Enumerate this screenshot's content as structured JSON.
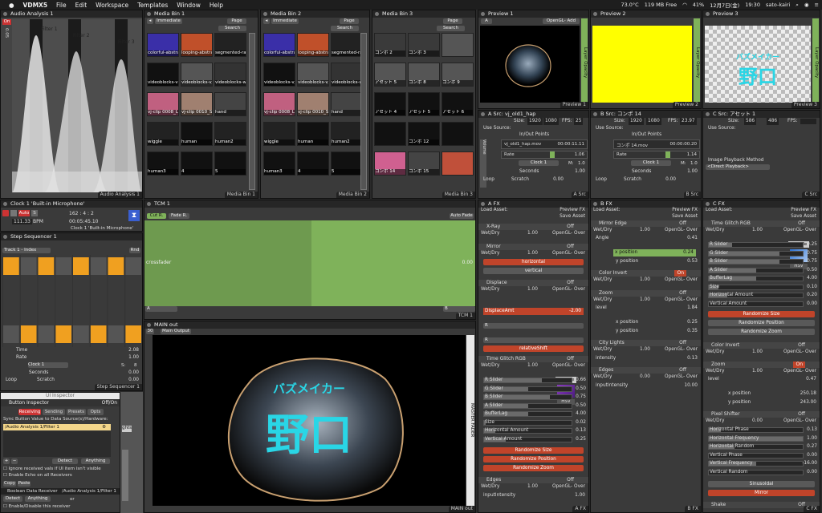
{
  "menubar": {
    "apple": "",
    "app": "VDMX5",
    "items": [
      "File",
      "Edit",
      "Workspace",
      "Templates",
      "Window",
      "Help"
    ],
    "status": {
      "temp": "73.0°C",
      "mem": "119 MB Free",
      "battery": "41%",
      "date": "12月7日(金)",
      "time": "19:30",
      "user": "sato-kairi"
    }
  },
  "audio_analysis": {
    "title": "Audio Analysis 1",
    "filters": [
      "Filter 1",
      "Filter 2",
      "Filter 3"
    ],
    "on": "On",
    "footer": "Audio Analysis 1",
    "level": "0.05"
  },
  "bin1": {
    "title": "Media Bin 1",
    "mode": "Immediate",
    "page": "Page",
    "search": "Search",
    "items": [
      "colorful-abstra",
      "looping-abstrac",
      "segmented-rac",
      "videoblocks-vi",
      "videoblocks-vj",
      "videoblocks-w",
      "vj-clip 0008_LA",
      "vj-clip 0010_SU",
      "hand",
      "wiggle",
      "human",
      "human2",
      "human3",
      "4",
      "5"
    ],
    "footer": "Media Bin 1"
  },
  "bin2": {
    "title": "Media Bin 2",
    "mode": "Immediate",
    "page": "Page",
    "search": "Search",
    "items": [
      "colorful-abstra",
      "looping-abstrac",
      "segmented-rac",
      "videoblocks-vj",
      "videoblocks-vj",
      "videoblocks-w",
      "vj-clip 0008_LA",
      "vj-clip 0010_SU",
      "hand",
      "wiggle",
      "human",
      "human2",
      "human3",
      "4",
      "5"
    ],
    "footer": "Media Bin 2"
  },
  "bin3": {
    "title": "Media Bin 3",
    "page": "Page",
    "search": "Search",
    "items": [
      "コンポ 2",
      "コンポ 3",
      "",
      "アセット 5",
      "コンポ 8",
      "コンポ 9",
      "アセット 4",
      "アセット 5",
      "アセット 6",
      "",
      "コンポ 12",
      "",
      "コンポ 14",
      "コンポ 15",
      ""
    ],
    "footer": "Media Bin 3"
  },
  "preview1": {
    "title": "Preview 1",
    "src": "A",
    "mode": "OpenGL- Add",
    "footer": "Preview 1",
    "side": "Layer Opacity",
    "val": "1.00"
  },
  "preview2": {
    "title": "Preview 2",
    "footer": "Preview 2",
    "side": "Layer Opacity",
    "val": "1.00"
  },
  "preview3": {
    "title": "Preview 3",
    "text_top": "バズメイカー",
    "text_main": "野口",
    "footer": "Preview 3",
    "side": "Layer Opacity",
    "val": "1.00"
  },
  "srcA": {
    "title": "A Src: vj_old1_hap",
    "size_lbl": "Size:",
    "w": "1920",
    "h": "1080",
    "fps_lbl": "FPS:",
    "fps": "25",
    "use_source": "Use Source:",
    "inout": "In/Out Points",
    "file": "vj_old1_hap.mov",
    "time": "00:00:11.11",
    "rate_lbl": "Rate",
    "rate": "1.06",
    "clock": "Clock 1",
    "m_lbl": "M:",
    "m": "1.0",
    "seconds": "Seconds",
    "seconds_val": "1.00",
    "loop": "Loop",
    "scratch": "Scratch",
    "scratch_val": "0.00",
    "volume": "Volume",
    "footer": "A Src"
  },
  "srcB": {
    "title": "B Src: コンポ 14",
    "size_lbl": "Size:",
    "w": "1920",
    "h": "1080",
    "fps_lbl": "FPS:",
    "fps": "23.97",
    "use_source": "Use Source:",
    "inout": "In/Out Points",
    "file": "コンポ 14.mov",
    "time": "00:00:00.20",
    "rate_lbl": "Rate",
    "rate": "1.14",
    "clock": "Clock 1",
    "m_lbl": "M:",
    "m": "1.0",
    "seconds": "Seconds",
    "seconds_val": "1.00",
    "loop": "Loop",
    "scratch": "Scratch",
    "scratch_val": "0.00",
    "footer": "B Src"
  },
  "srcC": {
    "title": "C Src: アセット 1",
    "size_lbl": "Size:",
    "w": "586",
    "h": "486",
    "fps_lbl": "FPS:",
    "fps": "",
    "use_source": "Use Source:",
    "method_lbl": "Image Playback Method",
    "method": "<Direct Playback>",
    "footer": "C Src"
  },
  "clock": {
    "title": "Clock 1 'Built-in Microphone'",
    "auto": "Auto",
    "s": "S",
    "time_sig": "162 : 4 : 2",
    "bpm": "111.33",
    "bpm_lbl": "BPM",
    "elapsed": "00:05:45.10",
    "source": "Clock 1 'Built-in Microphone'"
  },
  "stepseq": {
    "title": "Step Sequencer 1",
    "track": "Track 1 - Index",
    "rnd": "Rnd",
    "time_lbl": "Time",
    "time": "2.08",
    "rate_lbl": "Rate",
    "rate": "1.00",
    "clock": "Clock 1",
    "s_lbl": "S:",
    "s": "8",
    "seconds": "Seconds",
    "seconds_val": "0.00",
    "loop": "Loop",
    "scratch": "Scratch",
    "scratch_val": "0.00",
    "footer": "Step Sequencer 1"
  },
  "tcm": {
    "title": "TCM 1",
    "cut": "Cut R.",
    "fade": "Fade R.",
    "auto_fade": "Auto Fade",
    "label": "crossfader",
    "val": "0.00",
    "a": "A",
    "b": "B",
    "footer": "TCM 1"
  },
  "main_out": {
    "title": "MAIN out",
    "res": "30",
    "output": "Main Output",
    "text_top": "バズメイカー",
    "text_main": "野口",
    "fader": "MASTER FADER",
    "val": "1.00",
    "footer": "MAIN out"
  },
  "ui_inspector": {
    "title": "UI Inspector",
    "panel": "Button Inspector",
    "offon": "Off/On",
    "tabs": [
      "Receiving",
      "Sending",
      "Presets",
      "Opts"
    ],
    "sync_lbl": "Sync Button Value to Data Source(s)/Hardware:",
    "source": "/Audio Analysis 1/Filter 1",
    "detect": "Detect",
    "anything": "Anything",
    "chk1": "Ignore received vals if UI item isn't visible",
    "chk2": "Enable Echo on all Receivers",
    "copy": "Copy",
    "paste": "Paste",
    "bool_lbl": "Boolean Data Receiver",
    "bool_src": "/Audio Analysis 1/Filter 1",
    "detect2": "Detect",
    "anything2": "Anything",
    "or": "or",
    "enable": "Enable/Disable this receiver",
    "lights": "ghts"
  },
  "fxA": {
    "title": "A FX",
    "load": "Load Asset:",
    "preview": "Preview FX",
    "save": "Save Asset",
    "footer": "A FX",
    "sections": [
      {
        "name": "X-Ray",
        "off": "Off",
        "wd": "1.00",
        "blend": "OpenGL- Over"
      },
      {
        "name": "Mirror",
        "off": "Off",
        "wd": "1.00",
        "blend": "OpenGL- Over",
        "btns": [
          "horizontal",
          "vertical"
        ]
      },
      {
        "name": "Displace",
        "off": "Off",
        "wd": "1.00",
        "blend": "OpenGL- Over",
        "param": "DisplaceAmt",
        "pval": "-2.00",
        "r": "R",
        "btn": "relativeShift"
      },
      {
        "name": "Time Glitch RGB",
        "off": "Off",
        "wd": "1.00",
        "blend": "OpenGL- Over",
        "sliders": [
          [
            "R Slider",
            "0.66"
          ],
          [
            "G Slider",
            "0.50"
          ],
          [
            "B Slider",
            "0.75"
          ],
          [
            "A Slider",
            "0.50"
          ],
          [
            "BufferLag",
            "4.00"
          ],
          [
            "Size",
            "0.02"
          ],
          [
            "Horizontal Amount",
            "0.13"
          ],
          [
            "Vertical Amount",
            "0.25"
          ]
        ],
        "sample": "Sample",
        "hsv": "HSV",
        "btns": [
          "Randomize Size",
          "Randomize Position",
          "Randomize Zoom"
        ]
      },
      {
        "name": "Edges",
        "off": "Off",
        "wd": "1.00",
        "blend": "OpenGL- Over",
        "param": "inputIntensity",
        "pval": "1.00"
      }
    ]
  },
  "fxB": {
    "title": "B FX",
    "load": "Load Asset:",
    "preview": "Preview FX",
    "save": "Save Asset",
    "footer": "B FX",
    "mirror_edge": {
      "name": "Mirror Edge",
      "off": "Off",
      "wd": "1.00",
      "blend": "OpenGL- Over",
      "angle_lbl": "Angle",
      "angle": "0.41",
      "xpos_lbl": "x position",
      "xpos": "0.24",
      "ypos_lbl": "y position",
      "ypos": "0.53"
    },
    "color_invert": {
      "name": "Color Invert",
      "on": "On",
      "wd": "1.00",
      "blend": "OpenGL- Over"
    },
    "zoom": {
      "name": "Zoom",
      "off": "Off",
      "wd": "1.00",
      "blend": "OpenGL- Over",
      "level_lbl": "level",
      "level": "1.84",
      "xpos_lbl": "x position",
      "xpos": "0.25",
      "ypos_lbl": "y position",
      "ypos": "0.35"
    },
    "city": {
      "name": "City Lights",
      "off": "Off",
      "wd": "1.00",
      "blend": "OpenGL- Over",
      "int_lbl": "intensity",
      "int": "0.13"
    },
    "edges": {
      "name": "Edges",
      "off": "Off",
      "wd": "0.00",
      "blend": "OpenGL- Over",
      "int_lbl": "inputIntensity",
      "int": "10.00"
    }
  },
  "fxC": {
    "title": "C FX",
    "load": "Load Asset:",
    "preview": "Preview FX",
    "save": "Save Asset",
    "footer": "C FX",
    "tg": {
      "name": "Time Glitch RGB",
      "off": "Off",
      "wd": "1.00",
      "blend": "OpenGL- Over",
      "sliders": [
        [
          "R Slider",
          "0.25"
        ],
        [
          "G Slider",
          "0.75"
        ],
        [
          "B Slider",
          "0.75"
        ],
        [
          "A Slider",
          "0.50"
        ],
        [
          "BufferLag",
          "4.00"
        ],
        [
          "Size",
          "0.10"
        ],
        [
          "Horizontal Amount",
          "0.20"
        ],
        [
          "Vertical Amount",
          "0.00"
        ]
      ],
      "sample": "Sample",
      "hsv": "HSV",
      "btns": [
        "Randomize Size",
        "Randomize Position",
        "Randomize Zoom"
      ]
    },
    "ci": {
      "name": "Color Invert",
      "off": "Off",
      "wd": "1.00",
      "blend": "OpenGL- Over"
    },
    "zoom": {
      "name": "Zoom",
      "on": "On",
      "wd": "1.00",
      "blend": "OpenGL- Over",
      "level_lbl": "level",
      "level": "0.47",
      "xpos_lbl": "x position",
      "xpos": "250.18",
      "ypos_lbl": "y position",
      "ypos": "243.00"
    },
    "ps": {
      "name": "Pixel Shifter",
      "off": "Off",
      "wd": "0.00",
      "blend": "OpenGL- Over",
      "sliders": [
        [
          "Horizontal Phase",
          "0.13"
        ],
        [
          "Horizontal Frequency",
          "1.00"
        ],
        [
          "Horizontal Random",
          "0.27"
        ],
        [
          "Vertical Phase",
          "0.00"
        ],
        [
          "Vertical Frequency",
          "-16.00"
        ],
        [
          "Vertical Random",
          "0.00"
        ]
      ],
      "btns": [
        "Sinusoidal",
        "Mirror"
      ]
    },
    "shake": {
      "name": "Shake",
      "off": "Off"
    }
  },
  "colors": {
    "accent_orange": "#f0a020",
    "accent_red": "#c0442a",
    "accent_green": "#7fb25a",
    "text_cyan": "#29d6e6",
    "yellow": "#ffff00"
  }
}
